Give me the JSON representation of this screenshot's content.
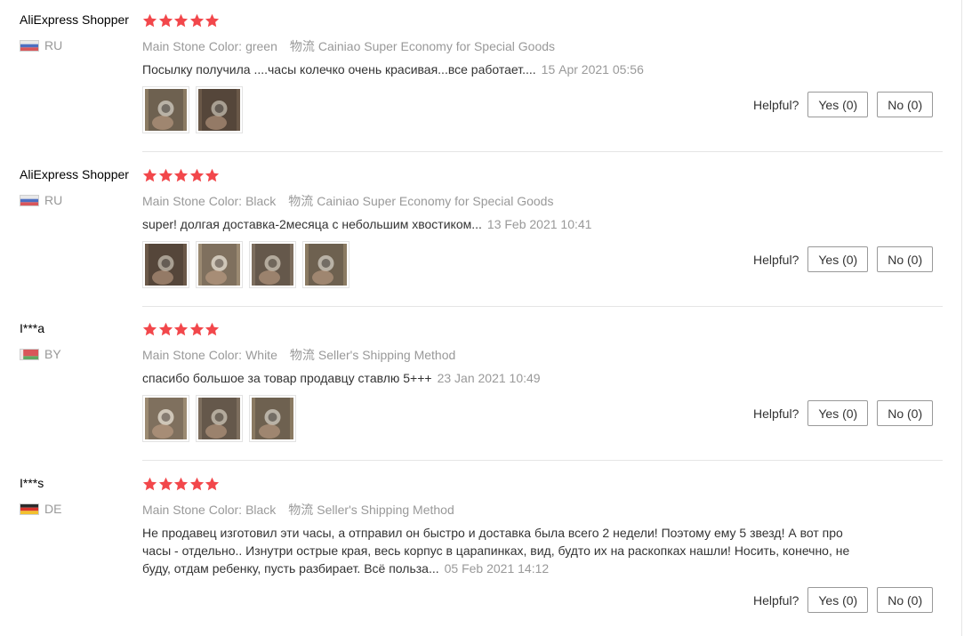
{
  "colors": {
    "star": "#f2474b",
    "text": "#333333",
    "muted": "#999999",
    "border": "#e5e5e5"
  },
  "reviews": [
    {
      "user": "AliExpress Shopper",
      "country": "RU",
      "flag": "ru-flag-icon",
      "rating": 5,
      "attr_label": "Main Stone Color:",
      "attr_value": "green",
      "shipping_label": "物流",
      "shipping_value": "Cainiao Super Economy for Special Goods",
      "comment": "Посылку получила ....часы колечко очень красивая...все работает....",
      "date": "15 Apr 2021 05:56",
      "photo_count": 2,
      "helpful_label": "Helpful?",
      "yes_label": "Yes (0)",
      "no_label": "No (0)"
    },
    {
      "user": "AliExpress Shopper",
      "country": "RU",
      "flag": "ru-flag-icon",
      "rating": 5,
      "attr_label": "Main Stone Color:",
      "attr_value": "Black",
      "shipping_label": "物流",
      "shipping_value": "Cainiao Super Economy for Special Goods",
      "comment": "super! долгая доставка-2месяца с небольшим хвостиком...",
      "date": "13 Feb 2021 10:41",
      "photo_count": 4,
      "helpful_label": "Helpful?",
      "yes_label": "Yes (0)",
      "no_label": "No (0)"
    },
    {
      "user": "I***a",
      "country": "BY",
      "flag": "by-flag-icon",
      "rating": 5,
      "attr_label": "Main Stone Color:",
      "attr_value": "White",
      "shipping_label": "物流",
      "shipping_value": "Seller's Shipping Method",
      "comment": "спасибо большое за товар продавцу ставлю 5+++",
      "date": "23 Jan 2021 10:49",
      "photo_count": 3,
      "helpful_label": "Helpful?",
      "yes_label": "Yes (0)",
      "no_label": "No (0)"
    },
    {
      "user": "I***s",
      "country": "DE",
      "flag": "de-flag-icon",
      "rating": 5,
      "attr_label": "Main Stone Color:",
      "attr_value": "Black",
      "shipping_label": "物流",
      "shipping_value": "Seller's Shipping Method",
      "comment": "Не продавец изготовил эти часы, а отправил он быстро и доставка была всего 2 недели! Поэтому ему 5 звезд! А вот про часы - отдельно.. Изнутри острые края, весь корпус в царапинках, вид, будто их на раскопках нашли! Носить, конечно, не буду, отдам ребенку, пусть разбирает. Всё польза...",
      "date": "05 Feb 2021 14:12",
      "photo_count": 0,
      "helpful_label": "Helpful?",
      "yes_label": "Yes (0)",
      "no_label": "No (0)"
    }
  ]
}
